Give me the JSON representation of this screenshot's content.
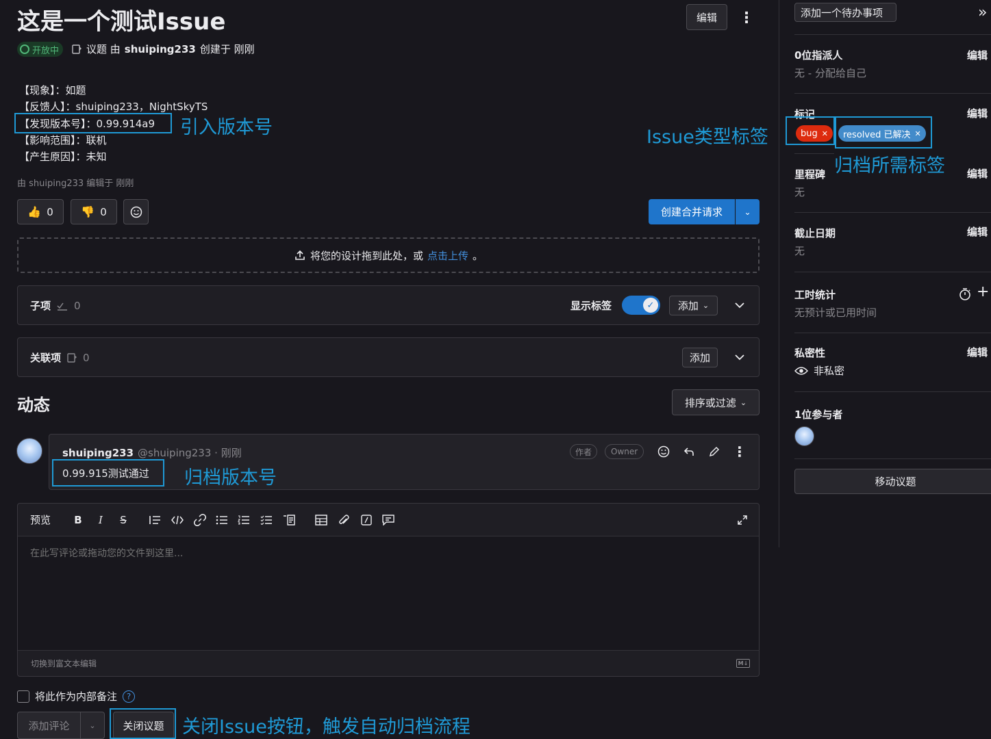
{
  "issue": {
    "title": "这是一个测试Issue",
    "status_badge": "开放中",
    "meta": {
      "prefix": "议题 由",
      "author": "shuiping233",
      "suffix": "创建于 刚刚"
    },
    "body_lines": [
      "【现象】：如题",
      "【反馈人】：shuiping233，NightSkyTS",
      "【发现版本号】：0.99.914a9",
      "【影响范围】：联机",
      "【产生原因】：未知"
    ],
    "edited_note": "由 shuiping233 编辑于 刚刚"
  },
  "header": {
    "edit_label": "编辑"
  },
  "reactions": {
    "thumbs_up": "0",
    "thumbs_down": "0"
  },
  "merge_request": {
    "label": "创建合并请求"
  },
  "design_upload": {
    "text": "将您的设计拖到此处，或",
    "link": "点击上传",
    "end": "。"
  },
  "children": {
    "title": "子项",
    "count": "0",
    "show_labels": "显示标签",
    "add_label": "添加"
  },
  "linked": {
    "title": "关联项",
    "count": "0",
    "add_label": "添加"
  },
  "activity": {
    "title": "动态",
    "sort_label": "排序或过滤"
  },
  "comment": {
    "author": "shuiping233",
    "handle": "@shuiping233 · 刚刚",
    "badge_author": "作者",
    "badge_owner": "Owner",
    "text": "0.99.915测试通过"
  },
  "editor": {
    "preview_label": "预览",
    "placeholder": "在此写评论或拖动您的文件到这里...",
    "switch_label": "切换到富文本编辑"
  },
  "footer": {
    "internal_note": "将此作为内部备注",
    "add_comment": "添加评论",
    "close_issue": "关闭议题"
  },
  "annotations": {
    "intro_version": "引入版本号",
    "issue_type_label": "Issue类型标签",
    "archive_label": "归档所需标签",
    "archive_version": "归档版本号",
    "close_button": "关闭Issue按钮，触发自动归档流程"
  },
  "sidebar": {
    "todo": "添加一个待办事项",
    "assignee_title": "0位指派人",
    "assignee_value": "无 - 分配给自己",
    "labels_title": "标记",
    "label_bug": "bug",
    "label_resolved": "resolved 已解决",
    "milestone_title": "里程碑",
    "milestone_value": "无",
    "due_title": "截止日期",
    "due_value": "无",
    "time_title": "工时统计",
    "time_value": "无预计或已用时间",
    "privacy_title": "私密性",
    "privacy_value": "非私密",
    "participants_title": "1位参与者",
    "move_label": "移动议题",
    "edit_label": "编辑"
  },
  "colors": {
    "background": "#18171d",
    "accent": "#1f75cb",
    "annotation": "#1f9ad6",
    "open_badge": "#2da160",
    "bug_label": "#dd2b0e",
    "resolved_label": "#428bca"
  }
}
